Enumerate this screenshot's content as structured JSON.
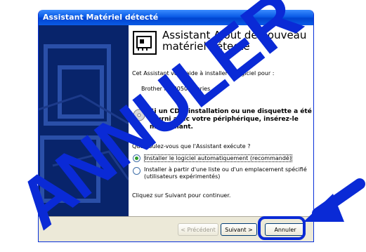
{
  "window": {
    "title": "Assistant Matériel détecté"
  },
  "wizard": {
    "heading_line1": "Assistant Ajout de nouveau",
    "heading_line2": "matériel détecté",
    "intro": "Cet Assistant vous aide à installer le logiciel pour :",
    "device": "Brother HL-8050N series",
    "cd_line1": "Si un CD d'installation ou une disquette a été",
    "cd_line2": "fourni avec votre périphérique, insérez-le",
    "cd_line3": "maintenant.",
    "question": "Que voulez-vous que l'Assistant exécute ?",
    "option_auto": "Installer le logiciel automatiquement (recommandé)",
    "option_manual_line1": "Installer à partir d'une liste ou d'un emplacement spécifié",
    "option_manual_line2": "(utilisateurs expérimentés)",
    "continue": "Cliquez sur Suivant pour continuer."
  },
  "buttons": {
    "back": "< Précédent",
    "next": "Suivant >",
    "cancel": "Annuler"
  },
  "stamp": {
    "text": "ANNULER"
  },
  "colors": {
    "stamp_blue": "#0a2ad6",
    "titlebar": "#0a5be6",
    "left_panel": "#08246b"
  }
}
